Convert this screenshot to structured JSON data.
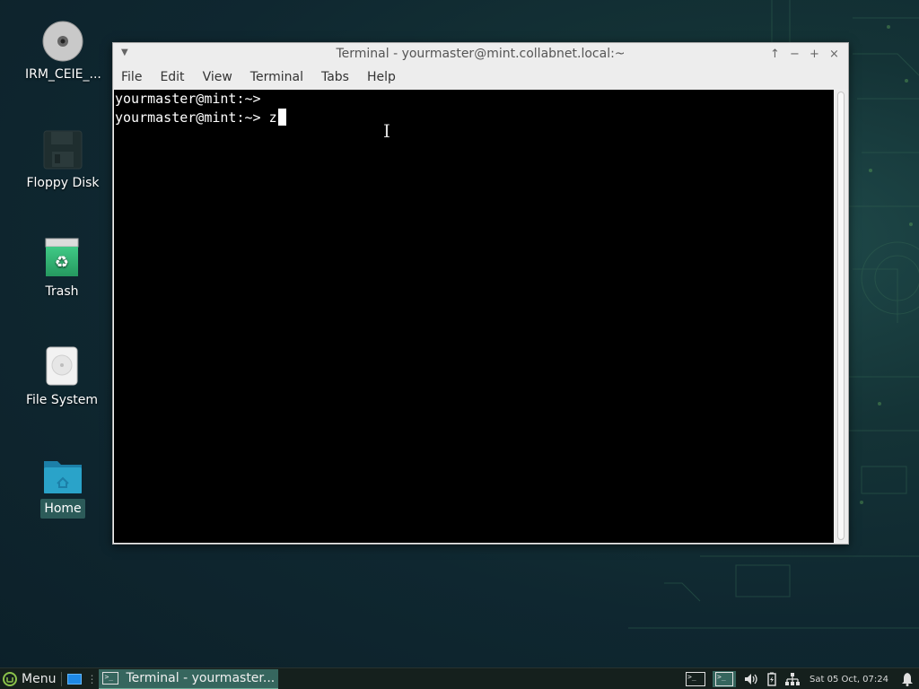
{
  "desktop": {
    "icons": [
      {
        "label": "IRM_CEIE_...",
        "icon": "optical-disc-icon"
      },
      {
        "label": "Floppy Disk",
        "icon": "floppy-disk-icon"
      },
      {
        "label": "Trash",
        "icon": "trash-icon"
      },
      {
        "label": "File System",
        "icon": "hard-drive-icon"
      },
      {
        "label": "Home",
        "icon": "home-folder-icon",
        "selected": true
      }
    ]
  },
  "window": {
    "title": "Terminal - yourmaster@mint.collabnet.local:~",
    "controls": {
      "up": "↑",
      "minimize": "−",
      "maximize": "+",
      "close": "×"
    },
    "menu": [
      "File",
      "Edit",
      "View",
      "Terminal",
      "Tabs",
      "Help"
    ],
    "terminal": {
      "lines": [
        "yourmaster@mint:~>",
        "yourmaster@mint:~> z"
      ]
    }
  },
  "taskbar": {
    "menu_label": "Menu",
    "task_label": "Terminal - yourmaster...",
    "clock": "Sat 05 Oct, 07:24"
  },
  "colors": {
    "taskbar_bg": "#15201d",
    "task_active": "#36665e",
    "selection": "#2c5b59"
  }
}
